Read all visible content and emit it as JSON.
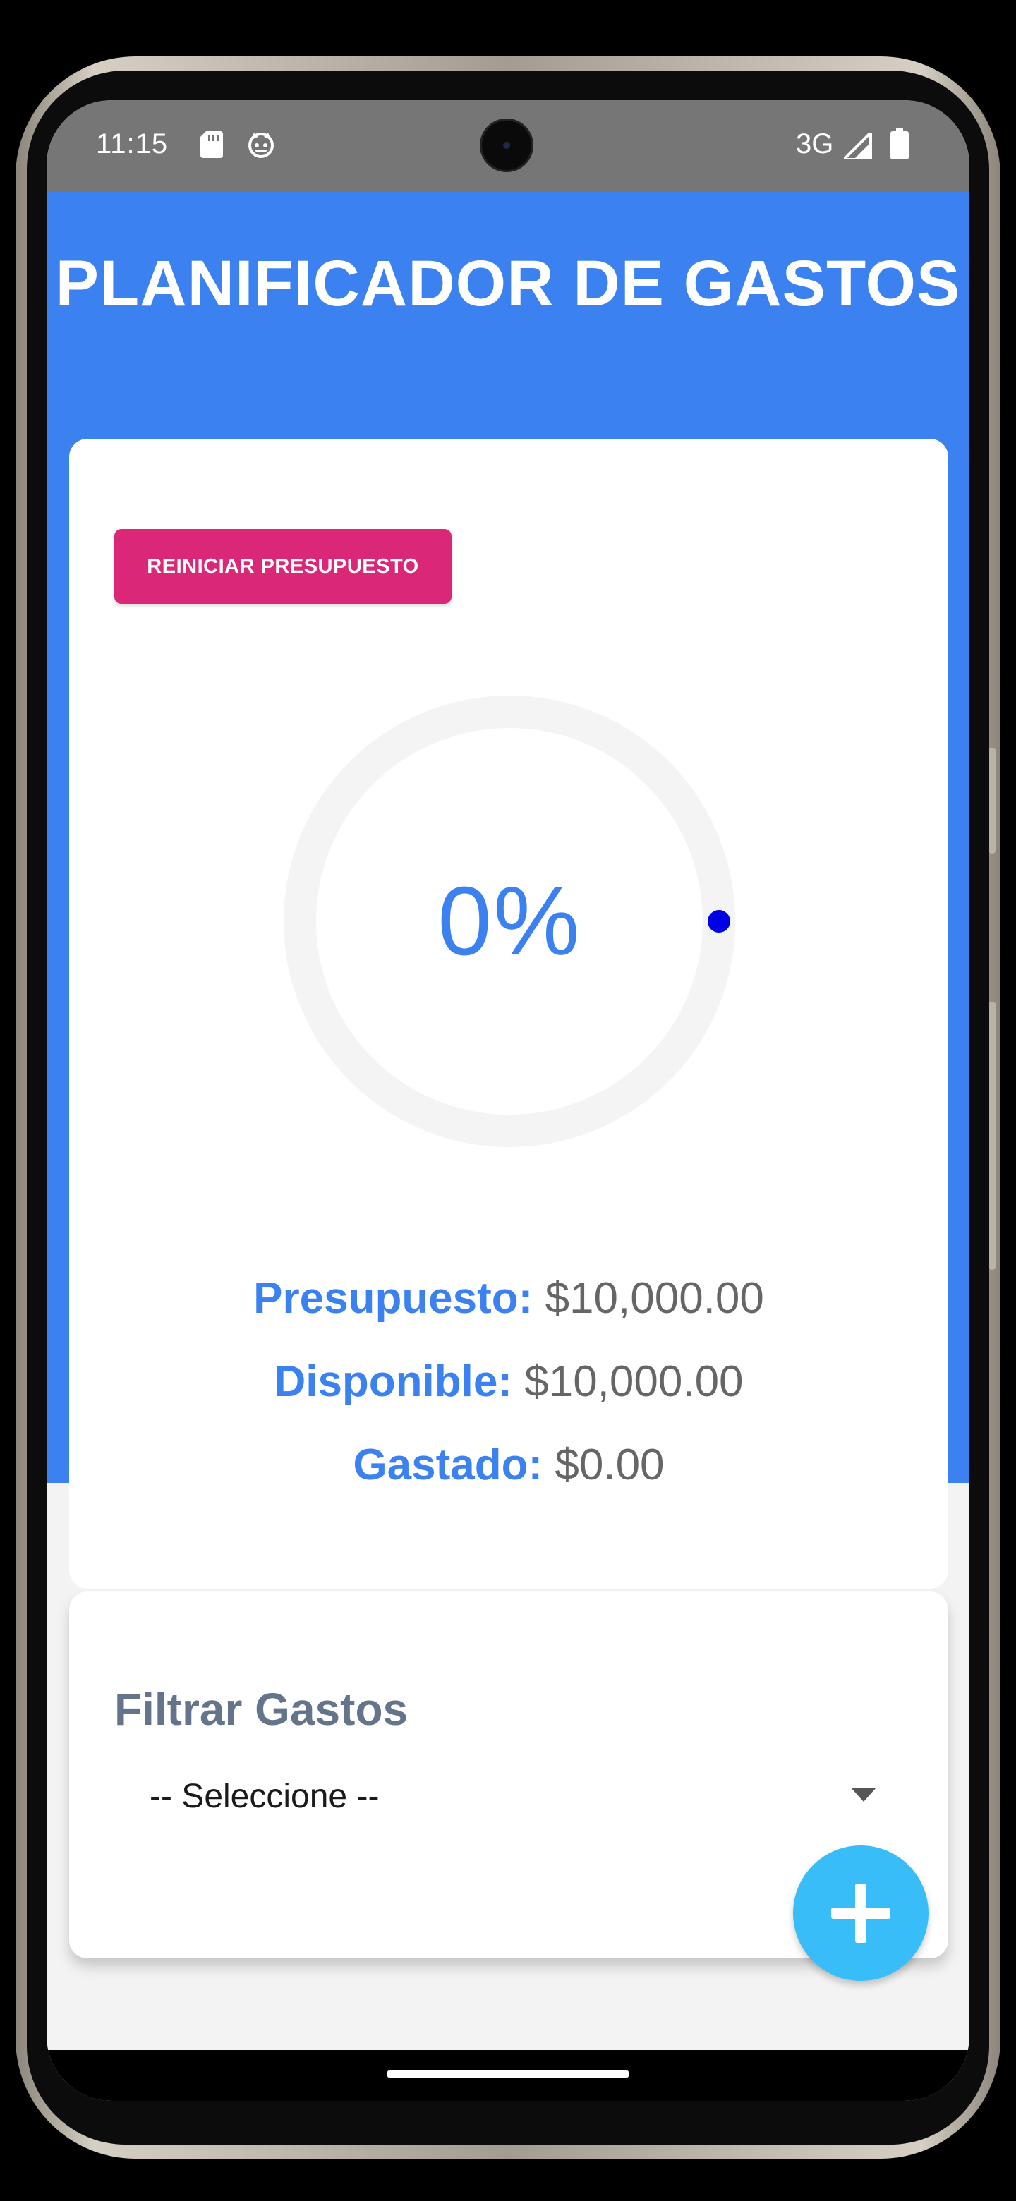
{
  "status_bar": {
    "time": "11:15",
    "network": "3G"
  },
  "header": {
    "title": "PLANIFICADOR DE GASTOS"
  },
  "budget": {
    "reset_label": "REINICIAR PRESUPUESTO",
    "progress_text": "0%",
    "progress_value": 0,
    "stats": [
      {
        "label": "Presupuesto:",
        "value": "$10,000.00"
      },
      {
        "label": "Disponible:",
        "value": "$10,000.00"
      },
      {
        "label": "Gastado:",
        "value": "$0.00"
      }
    ]
  },
  "filter": {
    "title": "Filtrar Gastos",
    "selected": "-- Seleccione --"
  },
  "colors": {
    "primary": "#3b82f0",
    "reset_button": "#db2777",
    "fab": "#38bdf8",
    "progress_track": "#f4f4f4",
    "progress_dot": "#0000e6"
  },
  "icons": [
    "sd-card-icon",
    "notification-face-icon",
    "signal-icon",
    "battery-icon",
    "chevron-down-icon",
    "plus-icon"
  ]
}
